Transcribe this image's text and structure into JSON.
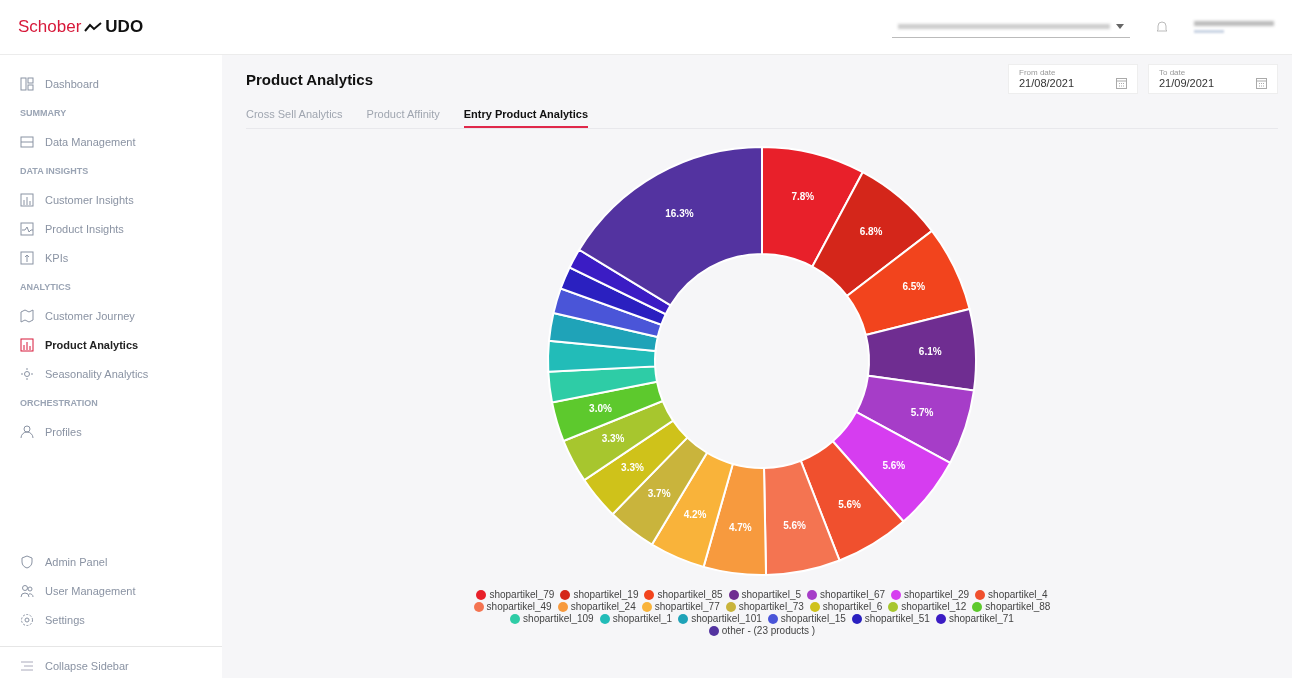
{
  "logo": {
    "brand": "Schober",
    "product": "UDO"
  },
  "sidebar": {
    "groups": [
      {
        "items": [
          {
            "label": "Dashboard",
            "selected": false
          }
        ]
      },
      {
        "heading": "SUMMARY",
        "items": [
          {
            "label": "Data Management",
            "selected": false
          }
        ]
      },
      {
        "heading": "DATA INSIGHTS",
        "items": [
          {
            "label": "Customer Insights",
            "selected": false
          },
          {
            "label": "Product Insights",
            "selected": false
          },
          {
            "label": "KPIs",
            "selected": false
          }
        ]
      },
      {
        "heading": "ANALYTICS",
        "items": [
          {
            "label": "Customer Journey",
            "selected": false
          },
          {
            "label": "Product Analytics",
            "selected": true
          },
          {
            "label": "Seasonality Analytics",
            "selected": false
          }
        ]
      },
      {
        "heading": "ORCHESTRATION",
        "items": [
          {
            "label": "Profiles",
            "selected": false
          }
        ]
      }
    ],
    "bottom_items": [
      {
        "label": "Admin Panel",
        "selected": false
      },
      {
        "label": "User Management",
        "selected": false
      },
      {
        "label": "Settings",
        "selected": false
      }
    ],
    "collapse": "Collapse Sidebar"
  },
  "page": {
    "title": "Product Analytics",
    "dates": [
      {
        "label": "From date",
        "value": "21/08/2021"
      },
      {
        "label": "To date",
        "value": "21/09/2021"
      }
    ],
    "tabs": [
      {
        "label": "Cross Sell Analytics",
        "selected": false
      },
      {
        "label": "Product Affinity",
        "selected": false
      },
      {
        "label": "Entry Product Analytics",
        "selected": true
      }
    ]
  },
  "chart_data": {
    "type": "donut",
    "legend": "bottom",
    "categories": [
      "shopartikel_79",
      "shopartikel_19",
      "shopartikel_85",
      "shopartikel_5",
      "shopartikel_67",
      "shopartikel_29",
      "shopartikel_4",
      "shopartikel_49",
      "shopartikel_24",
      "shopartikel_77",
      "shopartikel_73",
      "shopartikel_6",
      "shopartikel_12",
      "shopartikel_88",
      "shopartikel_109",
      "shopartikel_1",
      "shopartikel_101",
      "shopartikel_15",
      "shopartikel_51",
      "shopartikel_71",
      "other - (23 products )"
    ],
    "series": [
      {
        "values": [
          7.8,
          6.8,
          6.5,
          6.1,
          5.7,
          5.6,
          5.6,
          5.6,
          4.7,
          4.2,
          3.7,
          3.3,
          3.3,
          3.0,
          2.3,
          2.3,
          2.1,
          1.9,
          1.7,
          1.5,
          16.3
        ]
      }
    ],
    "colors": [
      "#e8202a",
      "#d4261a",
      "#f2441d",
      "#6f2d91",
      "#a63dc8",
      "#d63df0",
      "#f0502e",
      "#f47451",
      "#f79a3e",
      "#f9b33a",
      "#c9b43c",
      "#cfc21a",
      "#a7c62e",
      "#5dc92d",
      "#2ecca6",
      "#22bcb8",
      "#1fa3b8",
      "#4a55d8",
      "#2a20c0",
      "#3b1cc4",
      "#5333a0"
    ],
    "value_labels": [
      "7.8%",
      "6.8%",
      "6.5%",
      "6.1%",
      "5.7%",
      "5.6%",
      "5.6%",
      "5.6%",
      "4.7%",
      "4.2%",
      "3.7%",
      "3.3%",
      "3.3%",
      "3.0%",
      null,
      null,
      null,
      null,
      null,
      null,
      "16.3%"
    ]
  }
}
